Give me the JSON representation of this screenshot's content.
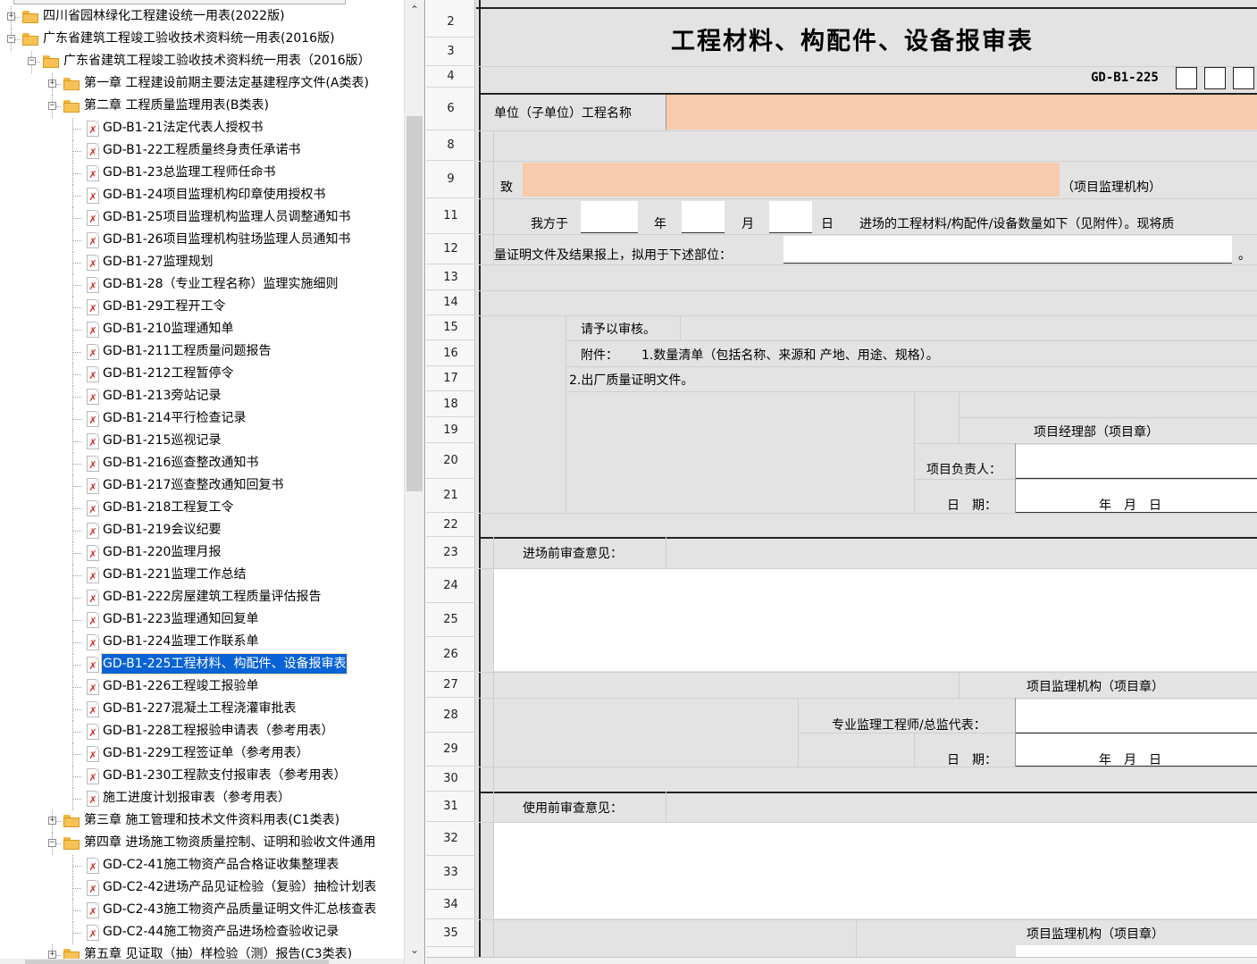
{
  "tree": {
    "items": [
      {
        "label": "四川省园林绿化工程建设统一用表(2022版)",
        "type": "folder",
        "level": 0,
        "expander": "+"
      },
      {
        "label": "广东省建筑工程竣工验收技术资料统一用表(2016版)",
        "type": "folder",
        "level": 0,
        "expander": "-"
      },
      {
        "label": "广东省建筑工程竣工验收技术资料统一用表（2016版）",
        "type": "folder",
        "level": 1,
        "expander": "-"
      },
      {
        "label": "第一章 工程建设前期主要法定基建程序文件(A类表)",
        "type": "folder",
        "level": 2,
        "expander": "+"
      },
      {
        "label": "第二章 工程质量监理用表(B类表)",
        "type": "folder",
        "level": 2,
        "expander": "-"
      },
      {
        "label": "GD-B1-21法定代表人授权书",
        "type": "pdf",
        "level": 3
      },
      {
        "label": "GD-B1-22工程质量终身责任承诺书",
        "type": "pdf",
        "level": 3
      },
      {
        "label": "GD-B1-23总监理工程师任命书",
        "type": "pdf",
        "level": 3
      },
      {
        "label": "GD-B1-24项目监理机构印章使用授权书",
        "type": "pdf",
        "level": 3
      },
      {
        "label": "GD-B1-25项目监理机构监理人员调整通知书",
        "type": "pdf",
        "level": 3
      },
      {
        "label": "GD-B1-26项目监理机构驻场监理人员通知书",
        "type": "pdf",
        "level": 3
      },
      {
        "label": "GD-B1-27监理规划",
        "type": "pdf",
        "level": 3
      },
      {
        "label": "GD-B1-28（专业工程名称）监理实施细则",
        "type": "pdf",
        "level": 3
      },
      {
        "label": "GD-B1-29工程开工令",
        "type": "pdf",
        "level": 3
      },
      {
        "label": "GD-B1-210监理通知单",
        "type": "pdf",
        "level": 3
      },
      {
        "label": "GD-B1-211工程质量问题报告",
        "type": "pdf",
        "level": 3
      },
      {
        "label": "GD-B1-212工程暂停令",
        "type": "pdf",
        "level": 3
      },
      {
        "label": "GD-B1-213旁站记录",
        "type": "pdf",
        "level": 3
      },
      {
        "label": "GD-B1-214平行检查记录",
        "type": "pdf",
        "level": 3
      },
      {
        "label": "GD-B1-215巡视记录",
        "type": "pdf",
        "level": 3
      },
      {
        "label": "GD-B1-216巡查整改通知书",
        "type": "pdf",
        "level": 3
      },
      {
        "label": "GD-B1-217巡查整改通知回复书",
        "type": "pdf",
        "level": 3
      },
      {
        "label": "GD-B1-218工程复工令",
        "type": "pdf",
        "level": 3
      },
      {
        "label": "GD-B1-219会议纪要",
        "type": "pdf",
        "level": 3
      },
      {
        "label": "GD-B1-220监理月报",
        "type": "pdf",
        "level": 3
      },
      {
        "label": "GD-B1-221监理工作总结",
        "type": "pdf",
        "level": 3
      },
      {
        "label": "GD-B1-222房屋建筑工程质量评估报告",
        "type": "pdf",
        "level": 3
      },
      {
        "label": "GD-B1-223监理通知回复单",
        "type": "pdf",
        "level": 3
      },
      {
        "label": "GD-B1-224监理工作联系单",
        "type": "pdf",
        "level": 3
      },
      {
        "label": "GD-B1-225工程材料、构配件、设备报审表",
        "type": "pdf",
        "level": 3,
        "selected": true
      },
      {
        "label": "GD-B1-226工程竣工报验单",
        "type": "pdf",
        "level": 3
      },
      {
        "label": "GD-B1-227混凝土工程浇灌审批表",
        "type": "pdf",
        "level": 3
      },
      {
        "label": "GD-B1-228工程报验申请表（参考用表）",
        "type": "pdf",
        "level": 3
      },
      {
        "label": "GD-B1-229工程签证单（参考用表）",
        "type": "pdf",
        "level": 3
      },
      {
        "label": "GD-B1-230工程款支付报审表（参考用表）",
        "type": "pdf",
        "level": 3
      },
      {
        "label": "施工进度计划报审表（参考用表）",
        "type": "pdf",
        "level": 3
      },
      {
        "label": "第三章 施工管理和技术文件资料用表(C1类表)",
        "type": "folder",
        "level": 2,
        "expander": "+"
      },
      {
        "label": "第四章 进场施工物资质量控制、证明和验收文件通用",
        "type": "folder",
        "level": 2,
        "expander": "-"
      },
      {
        "label": "GD-C2-41施工物资产品合格证收集整理表",
        "type": "pdf",
        "level": 3
      },
      {
        "label": "GD-C2-42进场产品见证检验（复验）抽检计划表",
        "type": "pdf",
        "level": 3
      },
      {
        "label": "GD-C2-43施工物资产品质量证明文件汇总核查表",
        "type": "pdf",
        "level": 3
      },
      {
        "label": "GD-C2-44施工物资产品进场检查验收记录",
        "type": "pdf",
        "level": 3
      },
      {
        "label": "第五章 见证取（抽）样检验（测）报告(C3类表)",
        "type": "folder",
        "level": 2,
        "expander": "+"
      }
    ]
  },
  "sheet": {
    "rows": [
      {
        "n": "2"
      },
      {
        "n": "3"
      },
      {
        "n": "4"
      },
      {
        "n": "6"
      },
      {
        "n": "8"
      },
      {
        "n": "9"
      },
      {
        "n": "11"
      },
      {
        "n": "12"
      },
      {
        "n": "13"
      },
      {
        "n": "14"
      },
      {
        "n": "15"
      },
      {
        "n": "16"
      },
      {
        "n": "17"
      },
      {
        "n": "18"
      },
      {
        "n": "19"
      },
      {
        "n": "20"
      },
      {
        "n": "21"
      },
      {
        "n": "22"
      },
      {
        "n": "23"
      },
      {
        "n": "24"
      },
      {
        "n": "25"
      },
      {
        "n": "26"
      },
      {
        "n": "27"
      },
      {
        "n": "28"
      },
      {
        "n": "29"
      },
      {
        "n": "30"
      },
      {
        "n": "31"
      },
      {
        "n": "32"
      },
      {
        "n": "33"
      },
      {
        "n": "34"
      },
      {
        "n": "35"
      }
    ],
    "title": "工程材料、构配件、设备报审表",
    "form_code": "GD-B1-225",
    "project_name_label": "单位（子单位）工程名称",
    "to_label": "致",
    "supervision_org_suffix": "（项目监理机构）",
    "line11_prefix": "我方于",
    "year": "年",
    "month": "月",
    "day": "日",
    "line11_suffix": "进场的工程材料/构配件/设备数量如下（见附件）。现将质",
    "line12": "量证明文件及结果报上，拟用于下述部位：",
    "period": "。",
    "please_review": "请予以审核。",
    "attachment_label": "附件：",
    "attachment1": "1.数量清单（包括名称、来源和 产地、用途、规格）。",
    "attachment2": "2.出厂质量证明文件。",
    "pm_dept": "项目经理部（项目章）",
    "pm_person": "项目负责人：",
    "date_label": "日　期：",
    "date_value": "年　月　日",
    "pre_entry_review": "进场前审查意见：",
    "supervision_org_seal": "项目监理机构（项目章）",
    "engineer_label": "专业监理工程师/总监代表：",
    "pre_use_review": "使用前审查意见：",
    "supervision_org_seal2": "项目监理机构（项目章）"
  },
  "colors": {
    "selection": "#0a63d6",
    "input_fill": "#f8cbad",
    "sheet_bg": "#e3e3e3",
    "pdf_mark": "#d22a2a",
    "folder": "#f7c155"
  }
}
